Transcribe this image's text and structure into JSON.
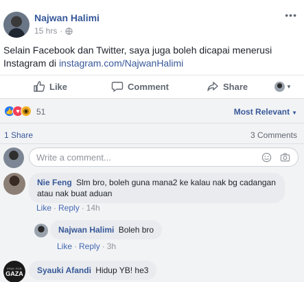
{
  "post": {
    "author": "Najwan Halimi",
    "time": "15 hrs",
    "more_label": "•••",
    "text": "Selain Facebook dan Twitter, saya juga boleh dicapai menerusi Instagram di",
    "link": "instagram.com/NajwanHalimi"
  },
  "actions": {
    "like_label": "Like",
    "comment_label": "Comment",
    "share_label": "Share"
  },
  "reactions": {
    "icons": [
      "like",
      "love",
      "wow"
    ],
    "count": "51",
    "sort_label": "Most Relevant"
  },
  "stats": {
    "shares": "1 Share",
    "comments": "3 Comments"
  },
  "composer": {
    "placeholder": "Write a comment..."
  },
  "comments": [
    {
      "name": "Nie Feng",
      "text": "Slm bro, boleh guna mana2 ke kalau nak bg cadangan atau nak buat aduan",
      "like": "Like",
      "reply": "Reply",
      "time": "14h"
    },
    {
      "name": "Najwan Halimi",
      "text": "Boleh bro",
      "like": "Like",
      "reply": "Reply",
      "time": "3h"
    },
    {
      "name": "Syauki Afandi",
      "text": "Hidup YB! he3",
      "avatar_text_top": "PRAY FOR",
      "avatar_text_main": "GAZA"
    }
  ],
  "colors": {
    "link_blue": "#385898",
    "like_blue": "#2078f4",
    "love_red": "#f33e58",
    "wow_yellow": "#f7b125",
    "comment_bg": "#f2f3f5",
    "bubble_bg": "#e9ebee"
  }
}
